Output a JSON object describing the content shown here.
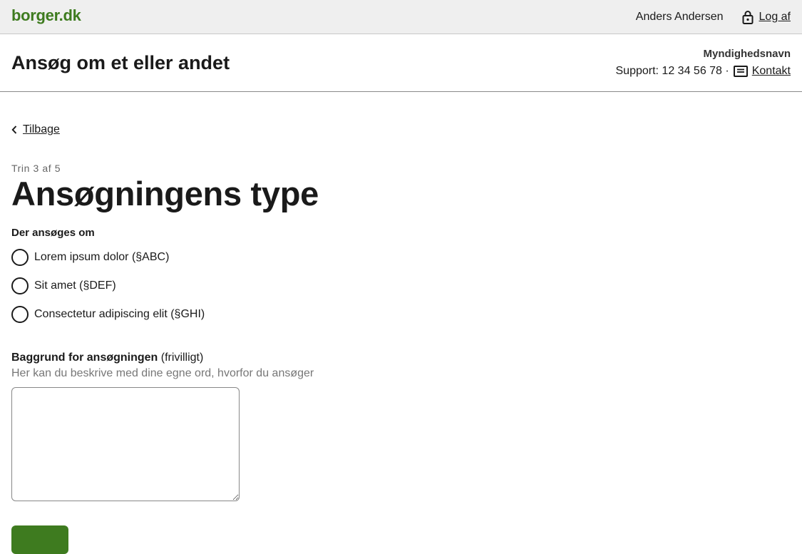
{
  "topbar": {
    "logo": "borger.dk",
    "user_name": "Anders Andersen",
    "logout_label": "Log af"
  },
  "header": {
    "title": "Ansøg om et eller andet",
    "authority": "Myndighedsnavn",
    "support": "Support: 12 34 56 78 ·",
    "contact_label": "Kontakt"
  },
  "main": {
    "back_label": "Tilbage",
    "step": "Trin 3 af 5",
    "title": "Ansøgningens type",
    "group_label": "Der ansøges om",
    "options": [
      "Lorem ipsum dolor (§ABC)",
      "Sit amet (§DEF)",
      "Consectetur adipiscing elit (§GHI)"
    ],
    "background_label": "Baggrund for ansøgningen",
    "background_optional": "(frivilligt)",
    "background_hint": "Her kan du beskrive med dine egne ord, hvorfor du ansøger",
    "textarea_value": ""
  },
  "colors": {
    "brand": "#3e7b1f",
    "topbar_bg": "#efefef"
  }
}
